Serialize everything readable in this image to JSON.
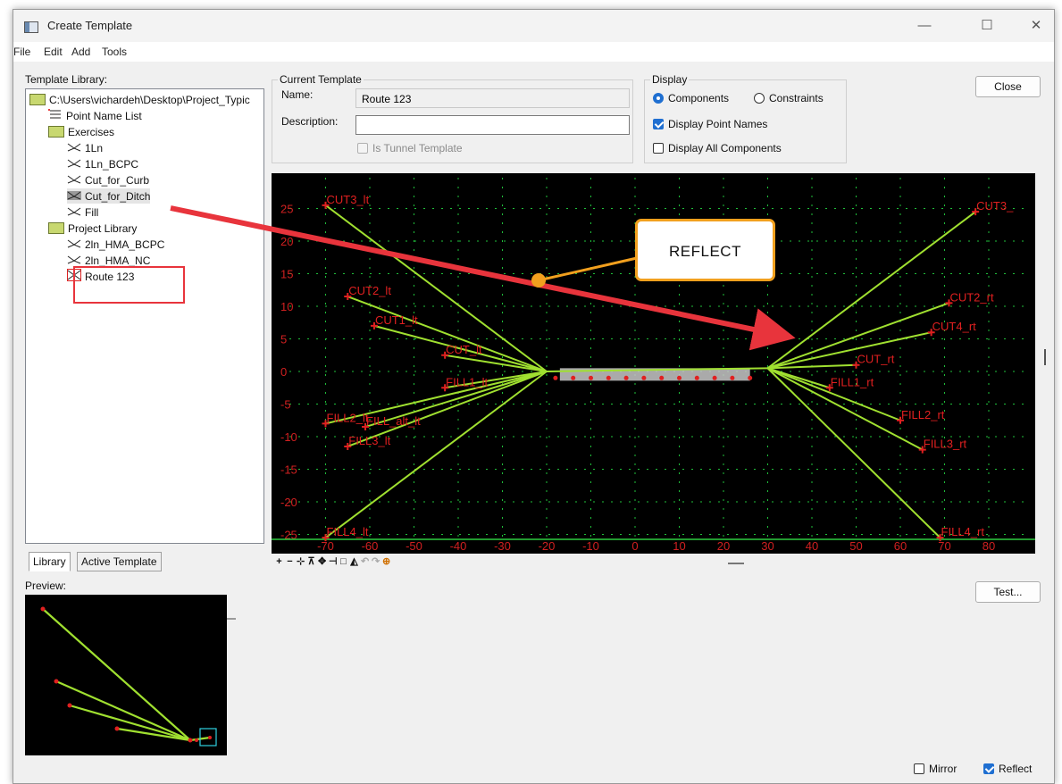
{
  "window": {
    "title": "Create Template",
    "controls": {
      "minimize": "—",
      "maximize": "☐",
      "close": "✕"
    }
  },
  "menu": [
    "File",
    "Edit",
    "Add",
    "Tools"
  ],
  "library": {
    "label": "Template Library:",
    "items": [
      {
        "text": "C:\\Users\\vichardeh\\Desktop\\Project_Typic",
        "icon": "folder-open-icon"
      },
      {
        "text": "Point Name List",
        "icon": "list-icon"
      },
      {
        "text": "Exercises",
        "icon": "folder-open-icon"
      },
      {
        "text": "1Ln",
        "icon": "template-icon"
      },
      {
        "text": "1Ln_BCPC",
        "icon": "template-icon"
      },
      {
        "text": "Cut_for_Curb",
        "icon": "template-icon"
      },
      {
        "text": "Cut_for_Ditch",
        "icon": "template-icon"
      },
      {
        "text": "Fill",
        "icon": "template-icon"
      },
      {
        "text": "Project Library",
        "icon": "folder-open-icon"
      },
      {
        "text": "2ln_HMA_BCPC",
        "icon": "template-icon"
      },
      {
        "text": "2ln_HMA_NC",
        "icon": "template-icon"
      },
      {
        "text": "Route 123",
        "icon": "template-active-icon"
      }
    ],
    "tabs": [
      "Library",
      "Active Template"
    ],
    "preview_label": "Preview:"
  },
  "current_template": {
    "group": "Current Template",
    "name_label": "Name:",
    "name_value": "Route 123",
    "description_label": "Description:",
    "description_value": "",
    "tunnel_label": "Is Tunnel Template"
  },
  "display": {
    "group": "Display",
    "components_label": "Components",
    "constraints_label": "Constraints",
    "point_names_label": "Display Point Names",
    "all_components_label": "Display All Components",
    "components_selected": true,
    "display_point_names": true,
    "display_all_components": false
  },
  "buttons": {
    "close": "Close",
    "test": "Test..."
  },
  "bottom": {
    "mirror_label": "Mirror",
    "reflect_label": "Reflect",
    "mirror": false,
    "reflect": true
  },
  "callout": {
    "text": "REFLECT"
  },
  "colors": {
    "accent": "#1f6fd1",
    "highlight": "#e8343c",
    "callout": "#f2a01e",
    "line": "#a0e030",
    "grid": "#2ecc40",
    "point": "#e02020"
  },
  "toolbar_icons": [
    "plus-icon",
    "minus-icon",
    "zoom-icon",
    "fit-icon",
    "move-icon",
    "pan-icon",
    "window-icon",
    "terrain-icon",
    "undo-icon",
    "redo-icon",
    "center-icon"
  ],
  "plot": {
    "x_ticks": [
      "-70",
      "-60",
      "-50",
      "-40",
      "-30",
      "-20",
      "-10",
      "0",
      "10",
      "20",
      "30",
      "40",
      "50",
      "60",
      "70",
      "80"
    ],
    "y_ticks": [
      "25",
      "20",
      "15",
      "10",
      "5",
      "0",
      "-5",
      "-10",
      "-15",
      "-20",
      "-25"
    ],
    "points": [
      {
        "name": "CUT3_lt",
        "x": -70,
        "y": 25.5
      },
      {
        "name": "CUT2_lt",
        "x": -65,
        "y": 11.5
      },
      {
        "name": "CUT1_lt",
        "x": -59,
        "y": 7
      },
      {
        "name": "CUT_lt",
        "x": -43,
        "y": 2.5
      },
      {
        "name": "FILL1_lt",
        "x": -43,
        "y": -2.5
      },
      {
        "name": "FILL2_lt",
        "x": -70,
        "y": -8
      },
      {
        "name": "FILL_alt_lt",
        "x": -61,
        "y": -8.5
      },
      {
        "name": "FILL3_lt",
        "x": -65,
        "y": -11.5
      },
      {
        "name": "FILL4_lt",
        "x": -70,
        "y": -25.5
      },
      {
        "name": "CUT3_",
        "x": 77,
        "y": 24.5
      },
      {
        "name": "CUT2_rt",
        "x": 71,
        "y": 10.5
      },
      {
        "name": "CUT4_rt",
        "x": 67,
        "y": 6
      },
      {
        "name": "CUT_rt",
        "x": 50,
        "y": 1
      },
      {
        "name": "FILL1_rt",
        "x": 44,
        "y": -2.5
      },
      {
        "name": "FILL2_rt",
        "x": 60,
        "y": -7.5
      },
      {
        "name": "FILL3_rt",
        "x": 65,
        "y": -12
      },
      {
        "name": "FILL4_rt",
        "x": 69,
        "y": -25.5
      }
    ]
  }
}
